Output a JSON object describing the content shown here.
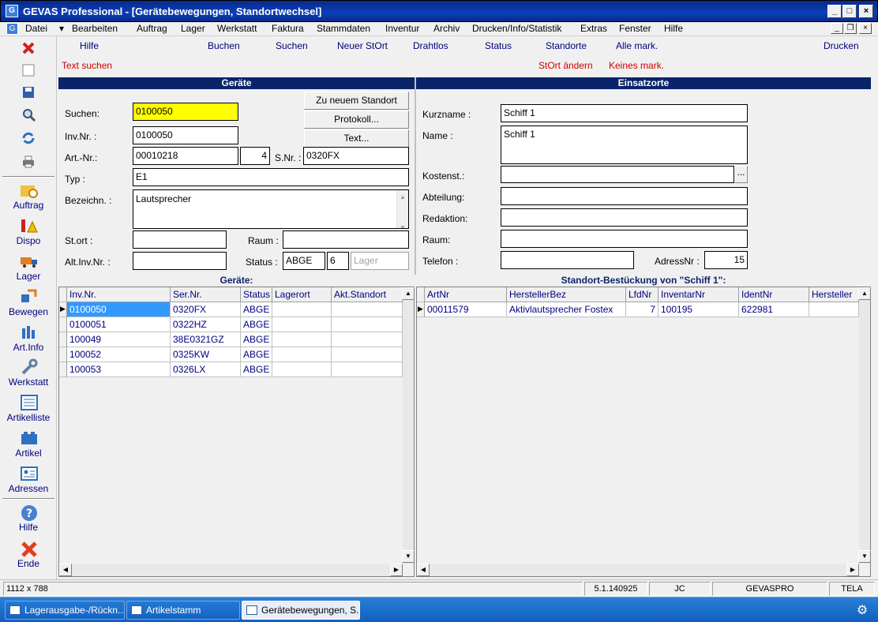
{
  "window": {
    "title": "GEVAS Professional - [Gerätebewegungen, Standortwechsel]"
  },
  "menu": [
    "Datei",
    "Bearbeiten",
    "Auftrag",
    "Lager",
    "Werkstatt",
    "Faktura",
    "Stammdaten",
    "Inventur",
    "Archiv",
    "Drucken/Info/Statistik",
    "Extras",
    "Fenster",
    "Hilfe"
  ],
  "sidebar": {
    "items": [
      "Auftrag",
      "Dispo",
      "Lager",
      "Bewegen",
      "Art.Info",
      "Werkstatt",
      "Artikelliste",
      "Artikel",
      "Adressen",
      "Hilfe",
      "Ende"
    ]
  },
  "toolbar": {
    "row1": [
      "Hilfe",
      "Buchen",
      "Suchen",
      "Neuer StOrt",
      "Drahtlos",
      "Status",
      "Standorte",
      "Alle mark.",
      "Drucken"
    ],
    "row2": [
      "Text suchen",
      "StOrt ändern",
      "Keines mark."
    ]
  },
  "geraete": {
    "header": "Geräte",
    "suchen_label": "Suchen:",
    "suchen_value": "0100050",
    "invnr_label": "Inv.Nr. :",
    "invnr_value": "0100050",
    "artnr_label": "Art.-Nr.:",
    "artnr_value": "00010218",
    "artnr_sub": "4",
    "snr_label": "S.Nr. :",
    "snr_value": "0320FX",
    "typ_label": "Typ :",
    "typ_value": "E1",
    "bezeichn_label": "Bezeichn. :",
    "bezeichn_value": "Lautsprecher",
    "stort_label": "St.ort :",
    "stort_value": "",
    "raum_label": "Raum :",
    "raum_value": "",
    "altinv_label": "Alt.Inv.Nr. :",
    "altinv_value": "",
    "status_label": "Status :",
    "status_value": "ABGE",
    "status_num": "6",
    "status_placeholder": "Lager",
    "btn_zu": "Zu neuem Standort",
    "btn_protokoll": "Protokoll...",
    "btn_text": "Text..."
  },
  "einsatz": {
    "header": "Einsatzorte",
    "kurz_label": "Kurzname :",
    "kurz_value": "Schiff 1",
    "name_label": "Name :",
    "name_value": "Schiff 1",
    "kostenst_label": "Kostenst.:",
    "kostenst_value": "",
    "kostenst_btn": "...",
    "abteilung_label": "Abteilung:",
    "abteilung_value": "",
    "redaktion_label": "Redaktion:",
    "redaktion_value": "",
    "raum_label": "Raum:",
    "raum_value": "",
    "telefon_label": "Telefon :",
    "telefon_value": "",
    "adressnr_label": "AdressNr :",
    "adressnr_value": "15"
  },
  "grid_left": {
    "title": "Geräte:",
    "columns": [
      "Inv.Nr.",
      "Ser.Nr.",
      "Status",
      "Lagerort",
      "Akt.Standort"
    ],
    "rows": [
      [
        "0100050",
        "0320FX",
        "ABGE",
        "",
        ""
      ],
      [
        "0100051",
        "0322HZ",
        "ABGE",
        "",
        ""
      ],
      [
        "100049",
        "38E0321GZ",
        "ABGE",
        "",
        ""
      ],
      [
        "100052",
        "0325KW",
        "ABGE",
        "",
        ""
      ],
      [
        "100053",
        "0326LX",
        "ABGE",
        "",
        ""
      ]
    ]
  },
  "grid_right": {
    "title": "Standort-Bestückung von \"Schiff 1\":",
    "columns": [
      "ArtNr",
      "HerstellerBez",
      "LfdNr",
      "InventarNr",
      "IdentNr",
      "Hersteller"
    ],
    "rows": [
      [
        "00011579",
        "Aktivlautsprecher Fostex",
        "7",
        "100195",
        "622981",
        ""
      ]
    ]
  },
  "statusbar": [
    "1112 x 788",
    "5.1.140925",
    "JC",
    "GEVASPRO",
    "TELA"
  ],
  "taskbar": [
    "Lagerausgabe-/Rückn...",
    "Artikelstamm",
    "Gerätebewegungen, S..."
  ],
  "colors": {
    "accent": "#0a246a",
    "link": "#00007f",
    "alert": "#d00000",
    "highlight": "#ffff00"
  }
}
